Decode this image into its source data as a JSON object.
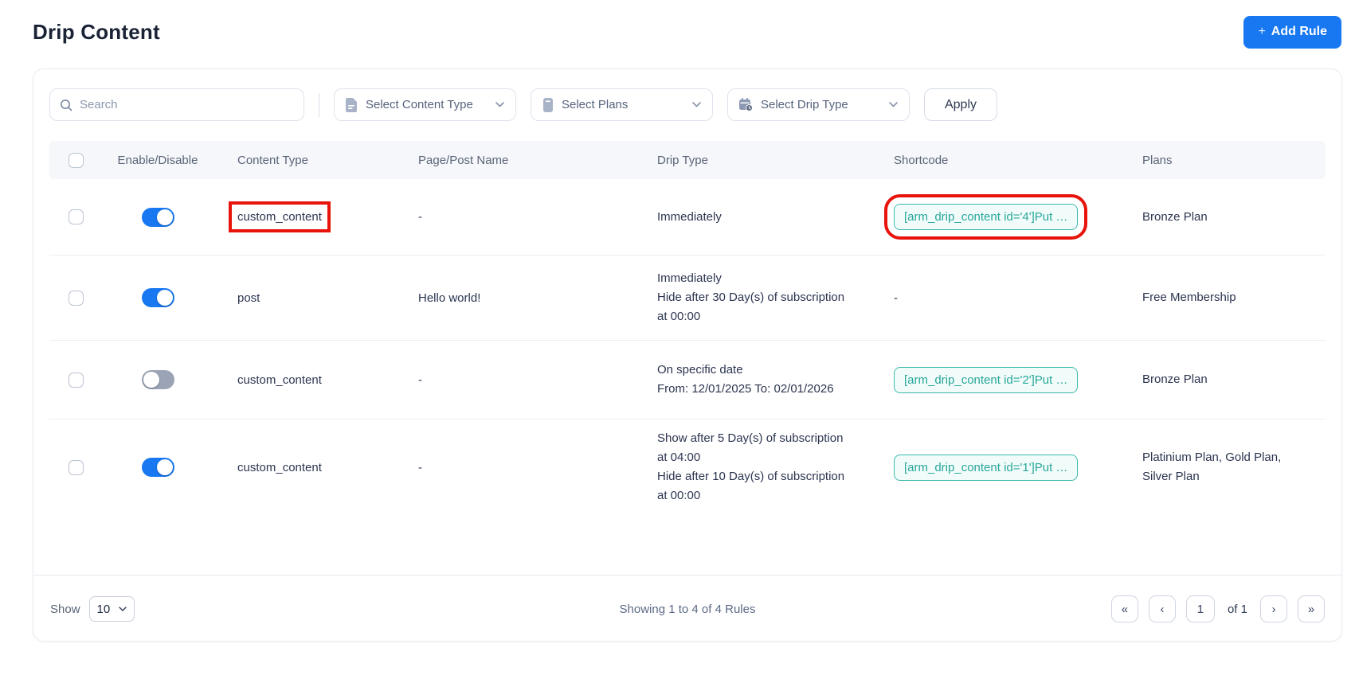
{
  "page": {
    "title": "Drip Content"
  },
  "header": {
    "add_rule_plus": "+",
    "add_rule_label": "Add Rule"
  },
  "toolbar": {
    "search_placeholder": "Search",
    "filters": [
      {
        "label": "Select Content Type",
        "icon": "content-type-icon"
      },
      {
        "label": "Select Plans",
        "icon": "plans-icon"
      },
      {
        "label": "Select Drip Type",
        "icon": "drip-type-icon"
      }
    ],
    "apply_label": "Apply"
  },
  "table": {
    "columns": [
      "Enable/Disable",
      "Content Type",
      "Page/Post Name",
      "Drip Type",
      "Shortcode",
      "Plans"
    ],
    "rows": [
      {
        "enabled": true,
        "content_type": "custom_content",
        "content_type_highlighted": true,
        "page_post_name": "-",
        "drip_type": "Immediately",
        "has_shortcode": true,
        "shortcode": "[arm_drip_content id='4']Put …",
        "shortcode_highlighted": true,
        "plans": "Bronze Plan"
      },
      {
        "enabled": true,
        "content_type": "post",
        "content_type_highlighted": false,
        "page_post_name": "Hello world!",
        "drip_type": "Immediately\nHide after 30 Day(s) of subscription\nat 00:00",
        "has_shortcode": false,
        "shortcode": "-",
        "shortcode_highlighted": false,
        "plans": "Free Membership"
      },
      {
        "enabled": false,
        "content_type": "custom_content",
        "content_type_highlighted": false,
        "page_post_name": "-",
        "drip_type": "On specific date\nFrom: 12/01/2025 To: 02/01/2026",
        "has_shortcode": true,
        "shortcode": "[arm_drip_content id='2']Put …",
        "shortcode_highlighted": false,
        "plans": "Bronze Plan"
      },
      {
        "enabled": true,
        "content_type": "custom_content",
        "content_type_highlighted": false,
        "page_post_name": "-",
        "drip_type": "Show after 5 Day(s) of subscription\nat 04:00\nHide after 10 Day(s) of subscription\nat 00:00",
        "has_shortcode": true,
        "shortcode": "[arm_drip_content id='1']Put …",
        "shortcode_highlighted": false,
        "plans": "Platinium Plan, Gold Plan, Silver Plan"
      }
    ]
  },
  "footer": {
    "show_label": "Show",
    "page_size": "10",
    "summary": "Showing 1 to 4 of 4 Rules",
    "pagination": {
      "first": "«",
      "prev": "‹",
      "page": "1",
      "of_label": "of 1",
      "next": "›",
      "last": "»"
    }
  },
  "colors": {
    "accent_blue": "#1778f2",
    "toggle_off_gray": "#9aa4b6",
    "shortcode_teal": "#27a69a",
    "highlight_red": "#e8130a"
  }
}
